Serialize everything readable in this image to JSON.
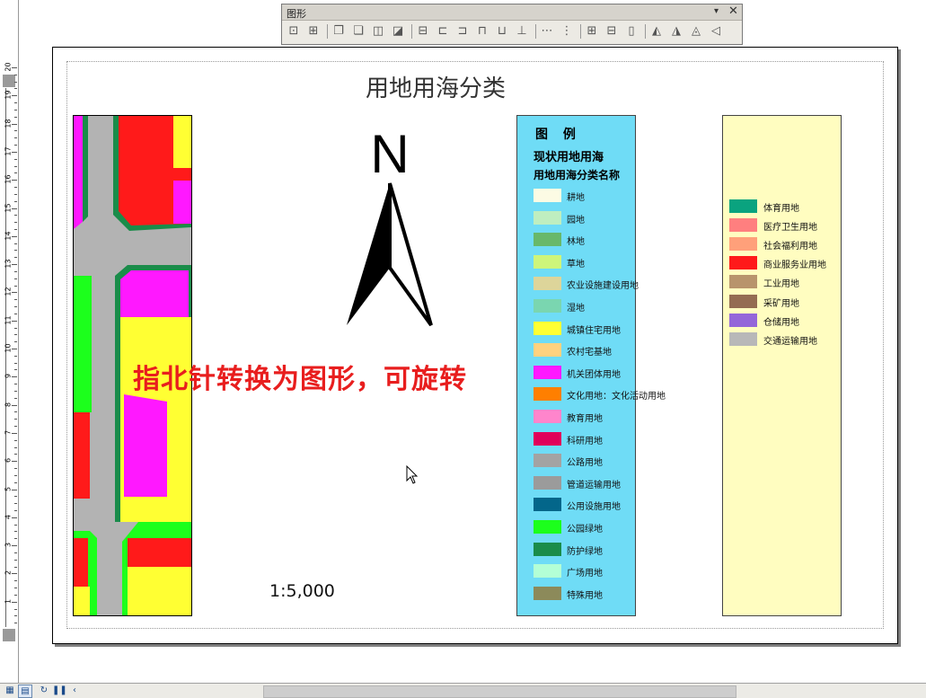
{
  "toolbar": {
    "title": "图形",
    "menu_arrow": "▾",
    "close": "✕",
    "buttons": [
      "group",
      "ungroup",
      "bring-front",
      "send-back",
      "bring-forward",
      "send-backward",
      "align-left",
      "align-center",
      "align-right",
      "align-top",
      "align-middle",
      "align-bottom",
      "distribute-h",
      "distribute-v",
      "fit-both",
      "fit-width",
      "fit-height",
      "rotate-left",
      "flip-h",
      "flip-v",
      "rotate-right"
    ]
  },
  "ruler": {
    "numbers": [
      "20",
      "19",
      "18",
      "17",
      "16",
      "15",
      "14",
      "13",
      "12",
      "11",
      "10",
      "9",
      "8",
      "7",
      "6",
      "5",
      "4",
      "3",
      "2",
      "1"
    ]
  },
  "map": {
    "title": "用地用海分类",
    "north_letter": "N",
    "scale": "1:5,000",
    "annotation": "指北针转换为图形，可旋转"
  },
  "legend": {
    "heading": "图  例",
    "subtitle1": "现状用地用海",
    "subtitle2": "用地用海分类名称",
    "items": [
      {
        "label": "耕地",
        "color": "#fcfbe4"
      },
      {
        "label": "园地",
        "color": "#bfeec0"
      },
      {
        "label": "林地",
        "color": "#68b86a"
      },
      {
        "label": "草地",
        "color": "#cef57a"
      },
      {
        "label": "农业设施建设用地",
        "color": "#ddd59a"
      },
      {
        "label": "湿地",
        "color": "#7ad6b0"
      },
      {
        "label": "城镇住宅用地",
        "color": "#ffff33"
      },
      {
        "label": "农村宅基地",
        "color": "#ffd27f"
      },
      {
        "label": "机关团体用地",
        "color": "#ff18ff"
      },
      {
        "label": "文化用地：文化活动用地",
        "color": "#ff7f00"
      },
      {
        "label": "教育用地",
        "color": "#ff85cc"
      },
      {
        "label": "科研用地",
        "color": "#e0005a"
      },
      {
        "label": "公路用地",
        "color": "#a3a3a3"
      },
      {
        "label": "管道运输用地",
        "color": "#9b9b9b"
      },
      {
        "label": "公用设施用地",
        "color": "#03668a"
      },
      {
        "label": "公园绿地",
        "color": "#1cff1c"
      },
      {
        "label": "防护绿地",
        "color": "#1a8c4a"
      },
      {
        "label": "广场用地",
        "color": "#b3ffd6"
      },
      {
        "label": "特殊用地",
        "color": "#8c8a5a"
      }
    ],
    "items2": [
      {
        "label": "体育用地",
        "color": "#0aa37f"
      },
      {
        "label": "医疗卫生用地",
        "color": "#ff7f7f"
      },
      {
        "label": "社会福利用地",
        "color": "#ffa07a"
      },
      {
        "label": "商业服务业用地",
        "color": "#ff1a1a"
      },
      {
        "label": "工业用地",
        "color": "#b8946c"
      },
      {
        "label": "采矿用地",
        "color": "#946c52"
      },
      {
        "label": "仓储用地",
        "color": "#9466d9"
      },
      {
        "label": "交通运输用地",
        "color": "#b8b8b8"
      }
    ]
  },
  "colors": {
    "road": "#b3b3b3",
    "border_green": "#1a8c4a",
    "commercial": "#ff1a1a",
    "residential": "#ffff33",
    "government": "#ff18ff",
    "park": "#1cff1c",
    "annotation": "#e81e1e"
  }
}
